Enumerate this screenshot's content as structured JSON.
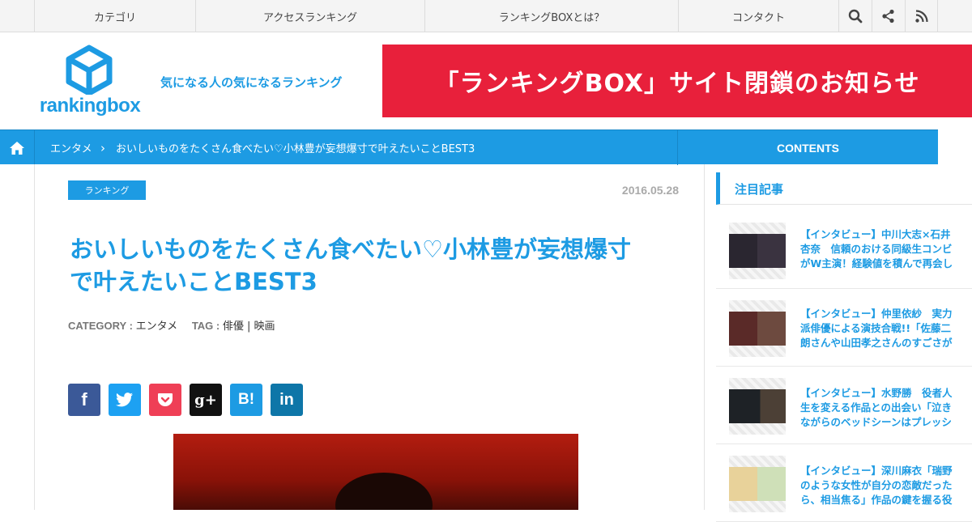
{
  "topnav": {
    "items": [
      "カテゴリ",
      "アクセスランキング",
      "ランキングBOXとは？",
      "コンタクト"
    ],
    "icons": [
      "search-icon",
      "share-icon",
      "rss-icon"
    ]
  },
  "header": {
    "logo_text": "rankingbox",
    "tagline": "気になる人の気になるランキング",
    "banner": "「ランキングBOX」サイト閉鎖のお知らせ"
  },
  "breadcrumb": {
    "category": "エンタメ",
    "separator": "›",
    "current": "おいしいものをたくさん食べたい♡小林豊が妄想爆寸で叶えたいことBEST3",
    "contents_label": "CONTENTS"
  },
  "article": {
    "badge": "ランキング",
    "date": "2016.05.28",
    "title_line1": "おいしいものをたくさん食べたい♡小林豊が妄想爆寸",
    "title_line2": "で叶えたいことBEST3",
    "category_label": "CATEGORY :",
    "category_value": "エンタメ",
    "tag_label": "TAG :",
    "tag_value": "俳優 | 映画"
  },
  "share": [
    {
      "label": "f",
      "color": "#3b5998"
    },
    {
      "label": "t",
      "color": "#1da1f2"
    },
    {
      "label": "p",
      "color": "#ef3f56"
    },
    {
      "label": "g+",
      "color": "#111111"
    },
    {
      "label": "B!",
      "color": "#1d9be3"
    },
    {
      "label": "in",
      "color": "#0e76a8"
    }
  ],
  "sidebar": {
    "heading": "注目記事",
    "items": [
      {
        "line1": "【インタビュー】中川大志×石井",
        "line2": "杏奈　信頼のおける同級生コンビ",
        "line3": "がW主演！経験値を積んで再会し"
      },
      {
        "line1": "【インタビュー】仲里依紗　実力",
        "line2": "派俳優による演技合戦!!「佐藤二",
        "line3": "朗さんや山田孝之さんのすごさが"
      },
      {
        "line1": "【インタビュー】水野勝　役者人",
        "line2": "生を変える作品との出会い「泣き",
        "line3": "ながらのベッドシーンはプレッシ"
      },
      {
        "line1": "【インタビュー】深川麻衣「瑞野",
        "line2": "のような女性が自分の恋敵だった",
        "line3": "ら、相当焦る」作品の鍵を握る役"
      }
    ]
  },
  "colors": {
    "brand": "#1d9be3",
    "banner": "#e8203b"
  }
}
